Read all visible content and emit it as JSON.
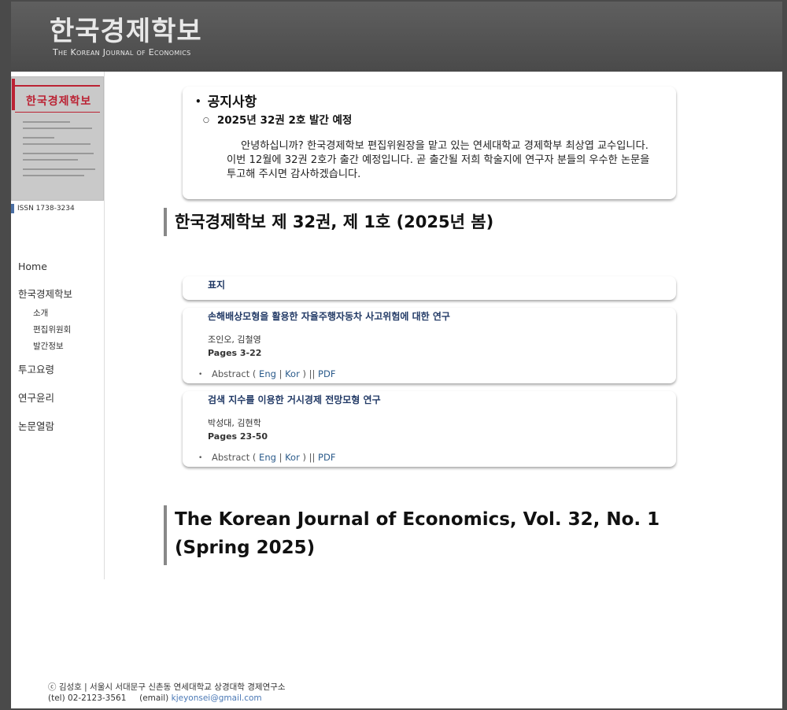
{
  "header": {
    "logo_ko": "한국경제학보",
    "logo_en_parts": [
      "The ",
      "Korean ",
      "Journal ",
      "of ",
      "Economics"
    ]
  },
  "sidebar": {
    "cover_title": "한국경제학보",
    "issn": "ISSN 1738-3234",
    "nav": {
      "home": "Home",
      "journal": "한국경제학보",
      "intro": "소개",
      "editors": "편집위원회",
      "publication": "발간정보",
      "submission": "투고요령",
      "ethics": "연구윤리",
      "papers": "논문열람"
    }
  },
  "notice": {
    "heading": "공지사항",
    "subheading": "2025년 32권 2호 발간 예정",
    "body": "안녕하십니까? 한국경제학보 편집위원장을 맡고 있는 연세대학교 경제학부 최상엽 교수입니다. 이번 12월에 32권 2호가 출간 예정입니다. 곧 출간될 저희 학술지에 연구자 분들의 우수한 논문을 투고해 주시면 감사하겠습니다."
  },
  "issue_ko": {
    "title": "한국경제학보 제 32권, 제 1호 (2025년 봄)",
    "cover_label": "표지",
    "papers": [
      {
        "title": "손해배상모형을 활용한 자율주행자동차 사고위험에 대한 연구",
        "authors": "조인오, 김철영",
        "pages": "Pages 3-22",
        "abstract": "Abstract (",
        "eng": "Eng",
        "sep": "|",
        "kor": "Kor",
        "close": ") ||",
        "pdf": "PDF"
      },
      {
        "title": "검색 지수를 이용한 거시경제 전망모형 연구",
        "authors": "박성대, 김현학",
        "pages": "Pages 23-50",
        "abstract": "Abstract (",
        "eng": "Eng",
        "sep": "|",
        "kor": "Kor",
        "close": ") ||",
        "pdf": "PDF"
      }
    ]
  },
  "issue_en": {
    "title_line1": "The Korean Journal of Economics, Vol. 32, No. 1",
    "title_line2": "(Spring 2025)"
  },
  "footer": {
    "line1": "ⓒ 김성호 | 서울시 서대문구 신촌동 연세대학교 상경대학 경제연구소",
    "tel": "(tel) 02-2123-3561",
    "email_label": "(email)",
    "email": "kjeyonsei@gmail.com"
  }
}
